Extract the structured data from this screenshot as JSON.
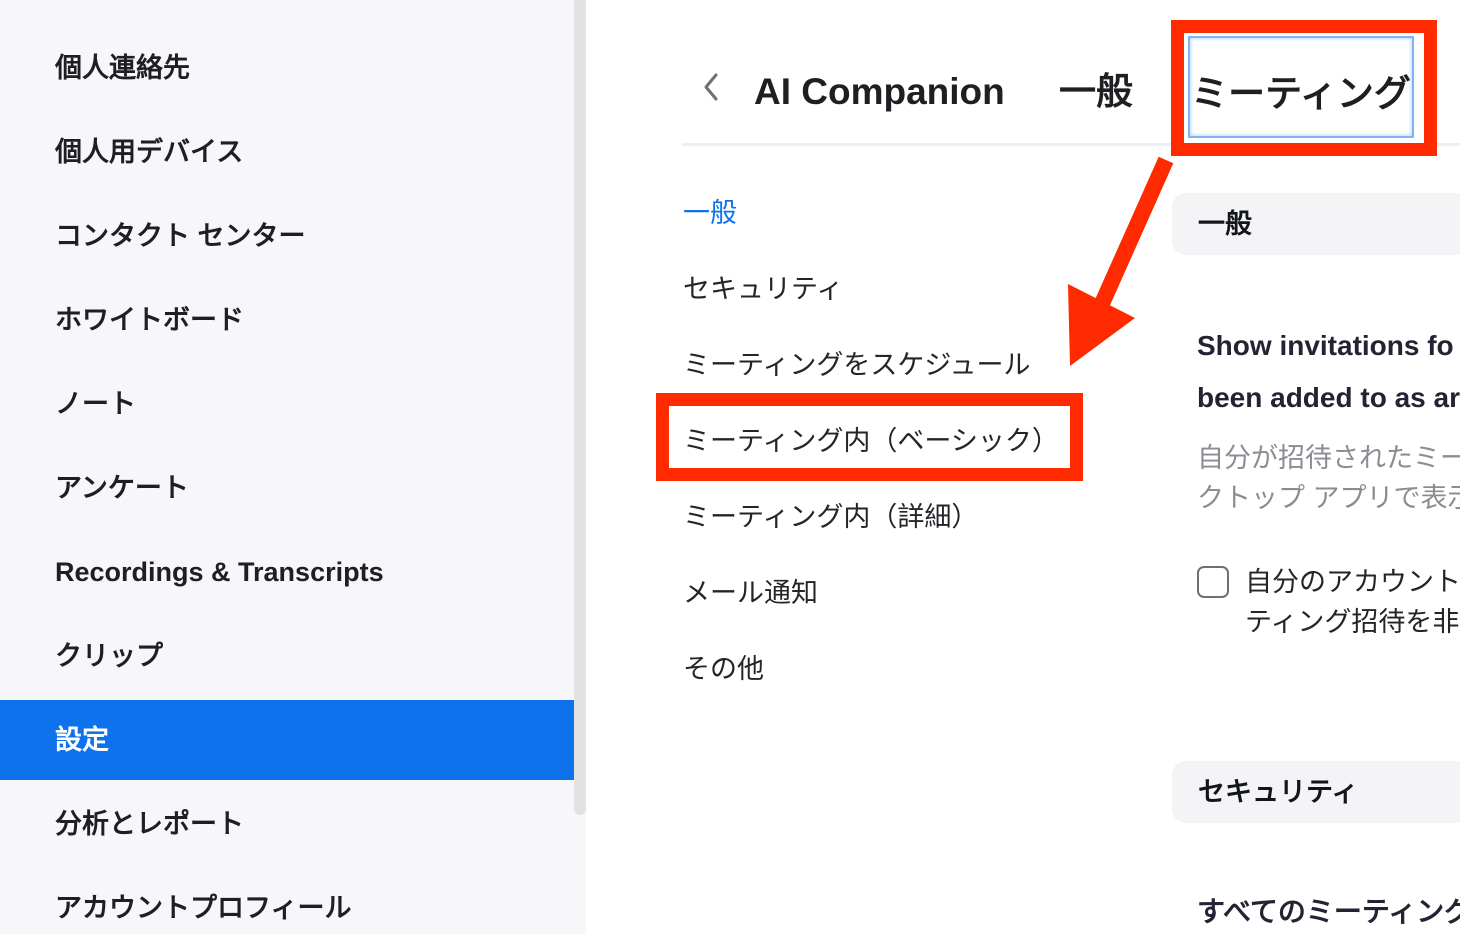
{
  "sidebar": {
    "items": [
      {
        "label": "個人連絡先",
        "active": false
      },
      {
        "label": "個人用デバイス",
        "active": false
      },
      {
        "label": "コンタクト センター",
        "active": false
      },
      {
        "label": "ホワイトボード",
        "active": false
      },
      {
        "label": "ノート",
        "active": false
      },
      {
        "label": "アンケート",
        "active": false
      },
      {
        "label": "Recordings & Transcripts",
        "active": false
      },
      {
        "label": "クリップ",
        "active": false
      },
      {
        "label": "設定",
        "active": true
      },
      {
        "label": "分析とレポート",
        "active": false
      },
      {
        "label": "アカウントプロフィール",
        "active": false
      }
    ],
    "active_color": "#0e72ed"
  },
  "tabs": {
    "back_icon": "chevron-left-icon",
    "items": [
      {
        "label": "AI Companion"
      },
      {
        "label": "一般"
      },
      {
        "label": "ミーティング",
        "active": true
      }
    ]
  },
  "subnav": {
    "items": [
      {
        "label": "一般",
        "active": true
      },
      {
        "label": "セキュリティ"
      },
      {
        "label": "ミーティングをスケジュール"
      },
      {
        "label": "ミーティング内（ベーシック）",
        "highlighted": true
      },
      {
        "label": "ミーティング内（詳細）"
      },
      {
        "label": "メール通知"
      },
      {
        "label": "その他"
      }
    ]
  },
  "content": {
    "sections": [
      {
        "header": "一般",
        "setting": {
          "title_line1": "Show invitations fo",
          "title_line2": "been added to as ar",
          "desc_line1": "自分が招待されたミー",
          "desc_line2": "クトップ アプリで表示",
          "checkbox_label_line1": "自分のアカウント",
          "checkbox_label_line2": "ティング招待を非",
          "checked": false
        }
      },
      {
        "header": "セキュリティ",
        "setting": {
          "title_line1": "すべてのミーティング"
        }
      }
    ]
  },
  "annotation": {
    "color": "#ff2a00"
  }
}
